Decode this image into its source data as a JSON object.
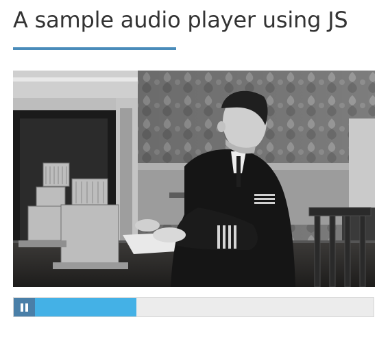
{
  "page": {
    "title": "A sample audio player using JS"
  },
  "artwork": {
    "description_icon": "album-art-image"
  },
  "player": {
    "state": "playing",
    "control_icon": "pause-icon",
    "progress": 0.3
  },
  "colors": {
    "accent_underline": "#4a8cba",
    "button": "#4a7fa8",
    "progress_fill": "#44b1e6",
    "track": "#ececec"
  }
}
